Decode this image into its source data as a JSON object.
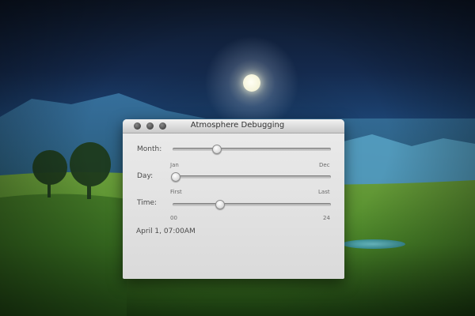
{
  "window": {
    "title": "Atmosphere Debugging"
  },
  "sliders": [
    {
      "label": "Month:",
      "min_label": "Jan",
      "max_label": "Dec",
      "value_fraction": 0.27
    },
    {
      "label": "Day:",
      "min_label": "First",
      "max_label": "Last",
      "value_fraction": 0.0
    },
    {
      "label": "Time:",
      "min_label": "00",
      "max_label": "24",
      "value_fraction": 0.29
    }
  ],
  "status": {
    "text": "April 1, 07:00AM"
  }
}
